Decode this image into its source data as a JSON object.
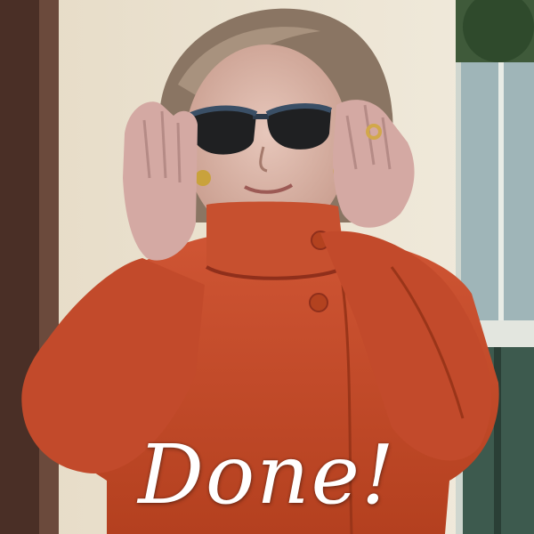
{
  "caption": {
    "text": "Done!",
    "color": "#ffffff"
  },
  "palette": {
    "coat": "#c44a2c",
    "coat_shadow": "#8f2f1b",
    "wall": "#ece4d2",
    "door_frame": "#4a2f26",
    "window_glass": "#9fb5b8",
    "hair": "#8a7563",
    "skin": "#d9b5a8"
  }
}
